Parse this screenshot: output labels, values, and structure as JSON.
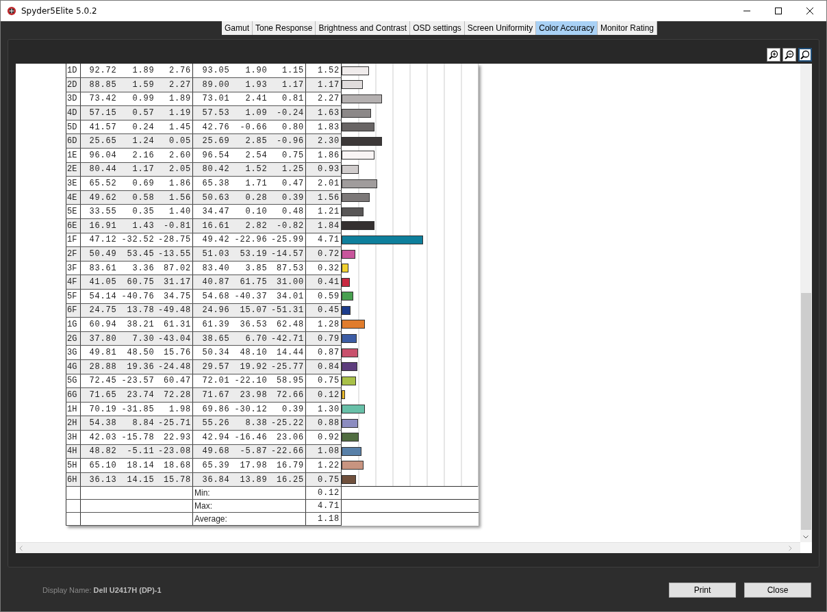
{
  "window": {
    "title": "Spyder5Elite 5.0.2"
  },
  "tabs": [
    {
      "label": "Gamut",
      "selected": false
    },
    {
      "label": "Tone Response",
      "selected": false
    },
    {
      "label": "Brightness and Contrast",
      "selected": false
    },
    {
      "label": "OSD settings",
      "selected": false
    },
    {
      "label": "Screen Uniformity",
      "selected": false
    },
    {
      "label": "Color Accuracy",
      "selected": true
    },
    {
      "label": "Monitor Rating",
      "selected": false
    }
  ],
  "zoom_tools": [
    {
      "kind": "zoom-in",
      "selected": false
    },
    {
      "kind": "zoom-out",
      "selected": false
    },
    {
      "kind": "zoom-fit",
      "selected": true
    }
  ],
  "report": {
    "rows": [
      {
        "cells": [
          "1D",
          "92.72",
          "1.89",
          "2.76",
          "93.05",
          "1.90",
          "1.15",
          "1.52"
        ],
        "level": 0.19,
        "color": "#f0ecec"
      },
      {
        "cells": [
          "2D",
          "88.85",
          "1.59",
          "2.27",
          "89.00",
          "1.93",
          "1.17",
          "1.17"
        ],
        "level": 0.146,
        "color": "#e0dcdc"
      },
      {
        "cells": [
          "3D",
          "73.42",
          "0.99",
          "1.89",
          "73.01",
          "2.41",
          "0.81",
          "2.27"
        ],
        "level": 0.284,
        "color": "#b4b0b0"
      },
      {
        "cells": [
          "4D",
          "57.15",
          "0.57",
          "1.19",
          "57.53",
          "1.09",
          "-0.24",
          "1.63"
        ],
        "level": 0.204,
        "color": "#8c8888"
      },
      {
        "cells": [
          "5D",
          "41.57",
          "0.24",
          "1.45",
          "42.76",
          "-0.66",
          "0.80",
          "1.83"
        ],
        "level": 0.229,
        "color": "#686464"
      },
      {
        "cells": [
          "6D",
          "25.65",
          "1.24",
          "0.05",
          "25.69",
          "2.85",
          "-0.96",
          "2.30"
        ],
        "level": 0.288,
        "color": "#3c3838"
      },
      {
        "cells": [
          "1E",
          "96.04",
          "2.16",
          "2.60",
          "96.54",
          "2.54",
          "0.75",
          "1.86"
        ],
        "level": 0.233,
        "color": "#f8f4f4"
      },
      {
        "cells": [
          "2E",
          "80.44",
          "1.17",
          "2.05",
          "80.42",
          "1.52",
          "1.25",
          "0.93"
        ],
        "level": 0.116,
        "color": "#d0cccc"
      },
      {
        "cells": [
          "3E",
          "65.52",
          "0.69",
          "1.86",
          "65.38",
          "1.71",
          "0.47",
          "2.01"
        ],
        "level": 0.251,
        "color": "#a09c9c"
      },
      {
        "cells": [
          "4E",
          "49.62",
          "0.58",
          "1.56",
          "50.63",
          "0.28",
          "0.39",
          "1.56"
        ],
        "level": 0.195,
        "color": "#7c7878"
      },
      {
        "cells": [
          "5E",
          "33.55",
          "0.35",
          "1.40",
          "34.47",
          "0.10",
          "0.48",
          "1.21"
        ],
        "level": 0.151,
        "color": "#585656"
      },
      {
        "cells": [
          "6E",
          "16.91",
          "1.43",
          "-0.81",
          "16.61",
          "2.82",
          "-0.82",
          "1.84"
        ],
        "level": 0.23,
        "color": "#343030"
      },
      {
        "cells": [
          "1F",
          "47.12",
          "-32.52",
          "-28.75",
          "49.42",
          "-22.96",
          "-25.99",
          "4.71"
        ],
        "level": 0.589,
        "color": "#0e7f9c"
      },
      {
        "cells": [
          "2F",
          "50.49",
          "53.45",
          "-13.55",
          "51.03",
          "53.19",
          "-14.57",
          "0.72"
        ],
        "level": 0.09,
        "color": "#c8559c"
      },
      {
        "cells": [
          "3F",
          "83.61",
          "3.36",
          "87.02",
          "83.40",
          "3.85",
          "87.53",
          "0.32"
        ],
        "level": 0.04,
        "color": "#f0d030"
      },
      {
        "cells": [
          "4F",
          "41.05",
          "60.75",
          "31.17",
          "40.87",
          "61.75",
          "31.00",
          "0.41"
        ],
        "level": 0.051,
        "color": "#c82840"
      },
      {
        "cells": [
          "5F",
          "54.14",
          "-40.76",
          "34.75",
          "54.68",
          "-40.37",
          "34.01",
          "0.59"
        ],
        "level": 0.074,
        "color": "#48a050"
      },
      {
        "cells": [
          "6F",
          "24.75",
          "13.78",
          "-49.48",
          "24.96",
          "15.07",
          "-51.31",
          "0.45"
        ],
        "level": 0.056,
        "color": "#1c3c8c"
      },
      {
        "cells": [
          "1G",
          "60.94",
          "38.21",
          "61.31",
          "61.39",
          "36.53",
          "62.48",
          "1.28"
        ],
        "level": 0.16,
        "color": "#e07c2c"
      },
      {
        "cells": [
          "2G",
          "37.80",
          "7.30",
          "-43.04",
          "38.65",
          "6.70",
          "-42.71",
          "0.79"
        ],
        "level": 0.099,
        "color": "#3c5ca4"
      },
      {
        "cells": [
          "3G",
          "49.81",
          "48.50",
          "15.76",
          "50.34",
          "48.10",
          "14.44",
          "0.87"
        ],
        "level": 0.109,
        "color": "#c8506c"
      },
      {
        "cells": [
          "4G",
          "28.88",
          "19.36",
          "-24.48",
          "29.57",
          "19.92",
          "-25.77",
          "0.84"
        ],
        "level": 0.105,
        "color": "#5c3c7c"
      },
      {
        "cells": [
          "5G",
          "72.45",
          "-23.57",
          "60.47",
          "72.01",
          "-22.10",
          "58.95",
          "0.75"
        ],
        "level": 0.094,
        "color": "#a8c048"
      },
      {
        "cells": [
          "6G",
          "71.65",
          "23.74",
          "72.28",
          "71.67",
          "23.98",
          "72.66",
          "0.12"
        ],
        "level": 0.015,
        "color": "#e8b828"
      },
      {
        "cells": [
          "1H",
          "70.19",
          "-31.85",
          "1.98",
          "69.86",
          "-30.12",
          "0.39",
          "1.30"
        ],
        "level": 0.163,
        "color": "#68c0a8"
      },
      {
        "cells": [
          "2H",
          "54.38",
          "8.84",
          "-25.71",
          "55.26",
          "8.38",
          "-25.22",
          "0.88"
        ],
        "level": 0.11,
        "color": "#8c8cc0"
      },
      {
        "cells": [
          "3H",
          "42.03",
          "-15.78",
          "22.93",
          "42.94",
          "-16.46",
          "23.06",
          "0.92"
        ],
        "level": 0.115,
        "color": "#506c40"
      },
      {
        "cells": [
          "4H",
          "48.82",
          "-5.11",
          "-23.08",
          "49.68",
          "-5.87",
          "-22.66",
          "1.08"
        ],
        "level": 0.135,
        "color": "#5880a8"
      },
      {
        "cells": [
          "5H",
          "65.10",
          "18.14",
          "18.68",
          "65.39",
          "17.98",
          "16.79",
          "1.22"
        ],
        "level": 0.153,
        "color": "#c89480"
      },
      {
        "cells": [
          "6H",
          "36.13",
          "14.15",
          "15.78",
          "36.84",
          "13.89",
          "16.25",
          "0.75"
        ],
        "level": 0.094,
        "color": "#70503c"
      }
    ],
    "summary": [
      {
        "label": "Min:",
        "value": "0.12"
      },
      {
        "label": "Max:",
        "value": "4.71"
      },
      {
        "label": "Average:",
        "value": "1.18"
      }
    ]
  },
  "footer": {
    "display_name": "Display Name: **Dell U2417H (DP)-1**"
  },
  "buttons": [
    {
      "label": "Print"
    },
    {
      "label": "Close"
    }
  ]
}
